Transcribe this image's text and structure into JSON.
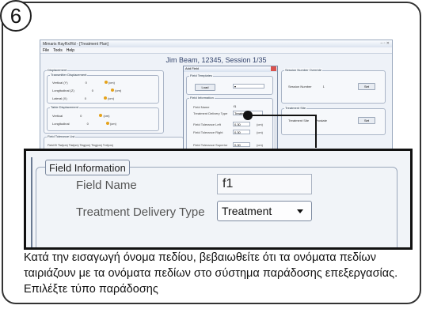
{
  "step_number": "6",
  "screenshot": {
    "window_title": "Mimaris RayRx/Rd - [Treatment Plan]",
    "menu": [
      "File",
      "Tools",
      "Help"
    ],
    "session_title": "Jim Beam, 12345, Session 1/35",
    "displacement": {
      "title": "Displacement",
      "transmitter_title": "Transmitter Displacement",
      "rows": [
        {
          "label": "Vertical (Y)",
          "value": "0",
          "unit": "(cm)"
        },
        {
          "label": "Longitudinal (Z)",
          "value": "0",
          "unit": "(cm)"
        },
        {
          "label": "Lateral (X)",
          "value": "0",
          "unit": "(cm)"
        }
      ],
      "table_title": "Table Displacement",
      "table_rows": [
        {
          "label": "Vertical",
          "value": "0",
          "unit": "(cm)"
        },
        {
          "label": "Longitudinal",
          "value": "0",
          "unit": "(cm)"
        }
      ]
    },
    "tolerance_list_title": "Field Tolerance List",
    "tolerance_columns": "Field ID   Tlat(cm)  Tlat(cm)  Tlng(cm)  Tlng(cm)  Tvrt(cm)",
    "session_number_box": {
      "title": "Session Number Override",
      "label": "Session Number",
      "value": "1",
      "button": "Set"
    },
    "treatment_site_box": {
      "title": "Treatment Site",
      "label": "Treatment Site",
      "value": "Prostate",
      "button": "Set"
    },
    "dialog": {
      "title": "Add Field",
      "templates_title": "Field Templates",
      "load_button": "Load",
      "info_title": "Field Information",
      "field_name_label": "Field Name",
      "field_name_value": "f1",
      "delivery_label": "Treatment Delivery Type",
      "delivery_value": "Treatment",
      "tol_left_label": "Field Tolerance Left",
      "tol_left_value": "0.30",
      "tol_right_label": "Field Tolerance Right",
      "tol_right_value": "0.30",
      "tol_sup_label": "Field Tolerance Superior",
      "tol_sup_value": "0.30",
      "unit": "(cm)"
    }
  },
  "zoom": {
    "group_title": "Field Information",
    "field_name_label": "Field Name",
    "field_name_value": "f1",
    "delivery_label": "Treatment Delivery Type",
    "delivery_value": "Treatment"
  },
  "caption": "Κατά την εισαγωγή όνομα πεδίου, βεβαιωθείτε ότι τα ονόματα πεδίων ταιριάζουν με τα ονόματα πεδίων στο σύστημα παράδοσης επεξεργασίας. Επιλέξτε τύπο παράδοσης",
  "colors": {
    "accent": "#e5a21a",
    "frame": "#333333",
    "window_bg": "#eef2f8"
  }
}
